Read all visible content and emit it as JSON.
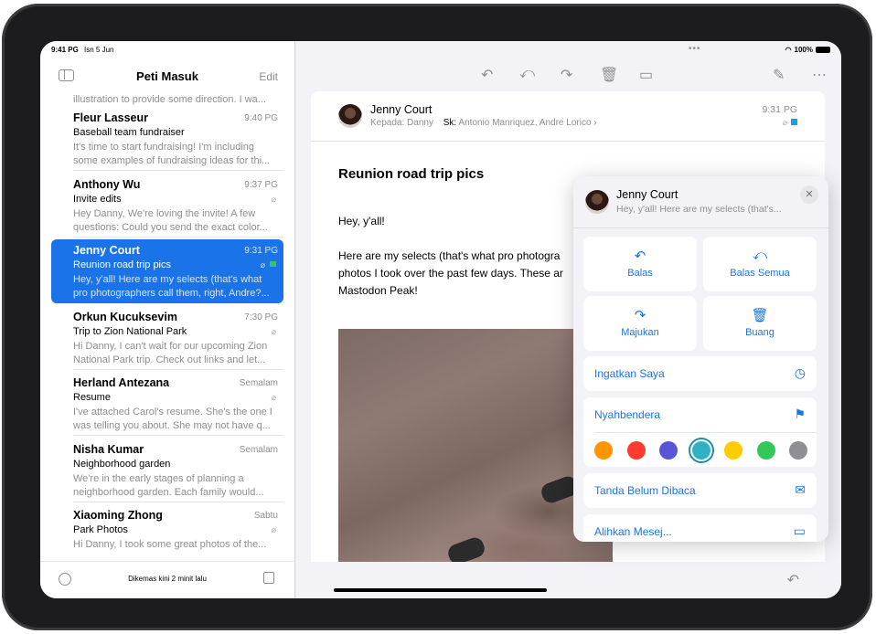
{
  "status": {
    "time": "9:41 PG",
    "date": "Isn 5 Jun",
    "battery": "100%"
  },
  "sidebar": {
    "title": "Peti Masuk",
    "edit": "Edit",
    "cut_preview": "illustration to provide some direction. I wa...",
    "mails": [
      {
        "sender": "Fleur Lasseur",
        "date": "9:40 PG",
        "subject": "Baseball team fundraiser",
        "preview": "It's time to start fundraising! I'm including some examples of fundraising ideas for thi...",
        "attachment": false,
        "flag": false,
        "selected": false
      },
      {
        "sender": "Anthony Wu",
        "date": "9:37 PG",
        "subject": "Invite edits",
        "preview": "Hey Danny, We're loving the invite! A few questions: Could you send the exact color...",
        "attachment": true,
        "flag": false,
        "selected": false
      },
      {
        "sender": "Jenny Court",
        "date": "9:31 PG",
        "subject": "Reunion road trip pics",
        "preview": "Hey, y'all! Here are my selects (that's what pro photographers call them, right, Andre?...",
        "attachment": true,
        "flag": true,
        "selected": true
      },
      {
        "sender": "Orkun Kucuksevim",
        "date": "7:30 PG",
        "subject": "Trip to Zion National Park",
        "preview": "Hi Danny, I can't wait for our upcoming Zion National Park trip. Check out links and let...",
        "attachment": true,
        "flag": false,
        "selected": false
      },
      {
        "sender": "Herland Antezana",
        "date": "Semalam",
        "subject": "Resume",
        "preview": "I've attached Carol's resume. She's the one I was telling you about. She may not have q...",
        "attachment": true,
        "flag": false,
        "selected": false
      },
      {
        "sender": "Nisha Kumar",
        "date": "Semalam",
        "subject": "Neighborhood garden",
        "preview": "We're in the early stages of planning a neighborhood garden. Each family would...",
        "attachment": false,
        "flag": false,
        "selected": false
      },
      {
        "sender": "Xiaoming Zhong",
        "date": "Sabtu",
        "subject": "Park Photos",
        "preview": "Hi Danny, I took some great photos of the...",
        "attachment": true,
        "flag": false,
        "selected": false
      }
    ],
    "updated": "Dikemas kini 2 minit lalu"
  },
  "message": {
    "from": "Jenny Court",
    "to_label": "Kepada:",
    "to": "Danny",
    "cc_label": "Sk:",
    "cc": "Antonio Manriquez, Andre Lorico",
    "time": "9:31 PG",
    "subject": "Reunion road trip pics",
    "greeting": "Hey, y'all!",
    "body_line1": "Here are my selects (that's what pro photogra",
    "body_line2": "photos I took over the past few days. These ar",
    "body_line3": "Mastodon Peak!"
  },
  "popover": {
    "name": "Jenny Court",
    "preview": "Hey, y'all! Here are my selects (that's...",
    "actions": {
      "reply": "Balas",
      "reply_all": "Balas Semua",
      "forward": "Majukan",
      "trash": "Buang"
    },
    "remind": "Ingatkan Saya",
    "flag": "Nyahbendera",
    "flag_colors": [
      "#ff9500",
      "#ff3b30",
      "#5856d6",
      "#30b0c7",
      "#ffcc00",
      "#34c759",
      "#8e8e93"
    ],
    "selected_color": "#30b0c7",
    "mark_unread": "Tanda Belum Dibaca",
    "move": "Alihkan Mesej..."
  },
  "colors": {
    "accent": "#1a73e8"
  }
}
